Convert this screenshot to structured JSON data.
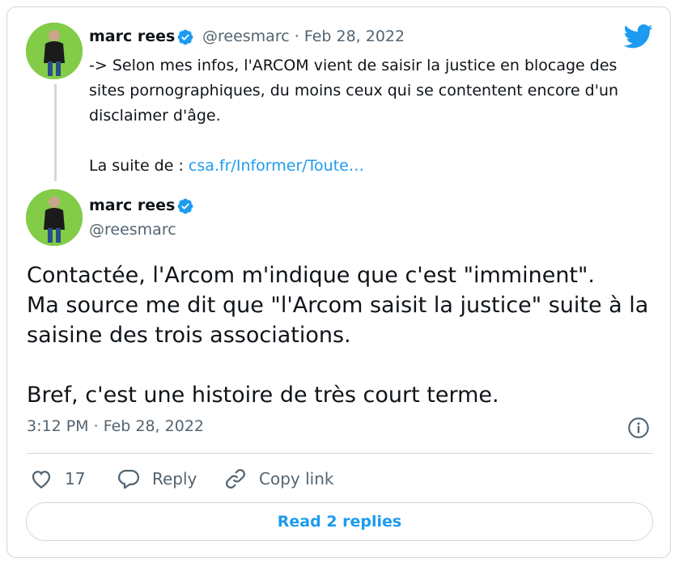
{
  "quoted_tweet": {
    "author_name": "marc rees",
    "handle": "@reesmarc",
    "separator": "·",
    "date": "Feb 28, 2022",
    "text_line1": "-> Selon mes infos, l'ARCOM vient de saisir la justice en blocage des sites pornographiques, du moins ceux qui se contentent encore d'un disclaimer d'âge.",
    "text_prefix": "La suite de : ",
    "link_text": "csa.fr/Informer/Toute…"
  },
  "main_tweet": {
    "author_name": "marc rees",
    "handle": "@reesmarc",
    "paragraph1_line1": "Contactée, l'Arcom m'indique que c'est \"imminent\".",
    "paragraph1_line2": "Ma source me dit que \"l'Arcom saisit la justice\" suite à la saisine des trois associations.",
    "paragraph2": "Bref, c'est une histoire de très court terme.",
    "time": "3:12 PM",
    "separator": "·",
    "date": "Feb 28, 2022"
  },
  "actions": {
    "like_count": "17",
    "reply_label": "Reply",
    "copy_link_label": "Copy link"
  },
  "read_replies_label": "Read 2 replies",
  "colors": {
    "accent": "#1d9bf0",
    "text": "#0f1419",
    "muted": "#536471",
    "border": "#cfd9de",
    "avatar_bg": "#7ac943"
  },
  "icons": [
    "verified-badge-icon",
    "twitter-bird-icon",
    "info-icon",
    "heart-icon",
    "reply-icon",
    "copy-link-icon"
  ]
}
